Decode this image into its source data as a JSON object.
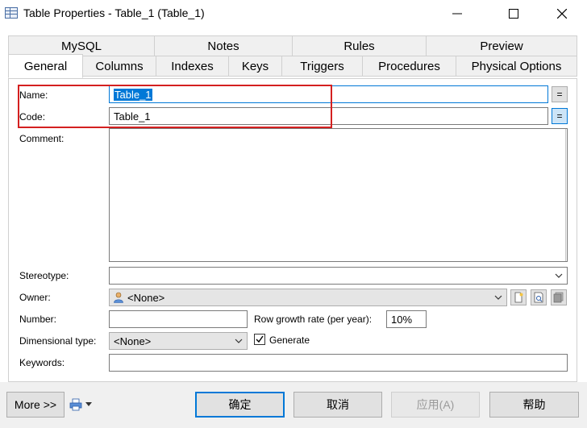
{
  "window": {
    "title": "Table Properties - Table_1 (Table_1)"
  },
  "tabs": {
    "row1": [
      "MySQL",
      "Notes",
      "Rules",
      "Preview"
    ],
    "row2": [
      "General",
      "Columns",
      "Indexes",
      "Keys",
      "Triggers",
      "Procedures",
      "Physical Options"
    ],
    "active": "General"
  },
  "form": {
    "name_label": "Name:",
    "name_value": "Table_1",
    "code_label": "Code:",
    "code_value": "Table_1",
    "eq_label": "=",
    "comment_label": "Comment:",
    "stereotype_label": "Stereotype:",
    "stereotype_value": "",
    "owner_label": "Owner:",
    "owner_value": "<None>",
    "number_label": "Number:",
    "number_value": "",
    "row_growth_label": "Row growth rate (per year):",
    "row_growth_value": "10%",
    "dimensional_label": "Dimensional type:",
    "dimensional_value": "<None>",
    "generate_label": "Generate",
    "generate_checked": true,
    "keywords_label": "Keywords:",
    "keywords_value": ""
  },
  "footer": {
    "more_label": "More >>",
    "ok_label": "确定",
    "cancel_label": "取消",
    "apply_label": "应用(A)",
    "help_label": "帮助"
  },
  "colors": {
    "accent": "#0078d7",
    "highlight_box": "#d42020"
  },
  "icons": [
    "table-icon",
    "minimize-icon",
    "maximize-icon",
    "close-icon",
    "user-icon",
    "new-icon",
    "properties-icon",
    "select-icon",
    "printer-icon",
    "chevron-down-icon"
  ]
}
